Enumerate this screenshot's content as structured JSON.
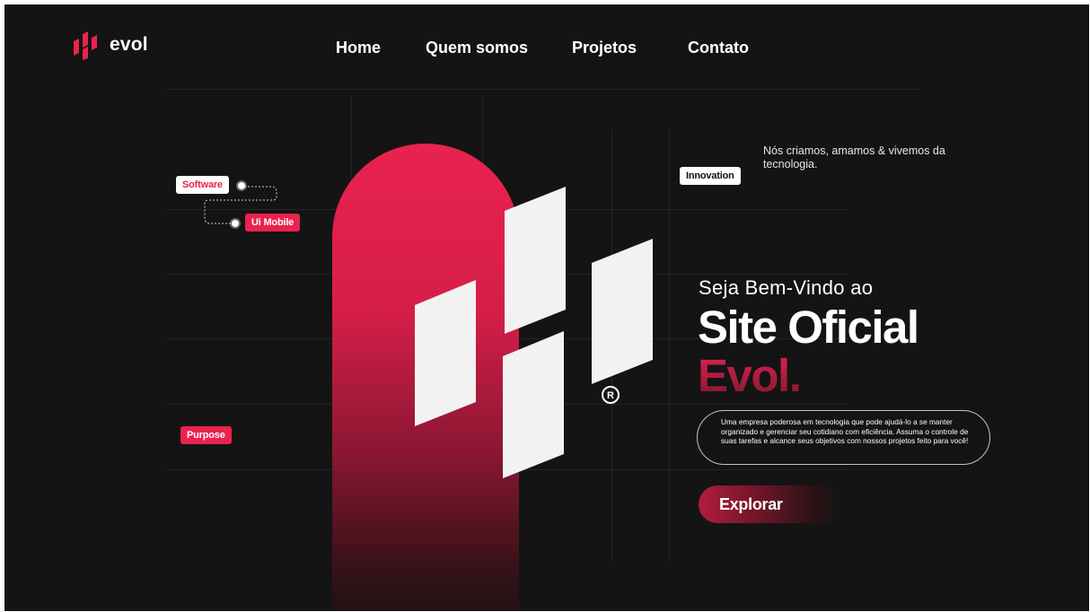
{
  "brand": {
    "name": "evol",
    "logo_icon": "evol-logo-icon",
    "accent": "#e8234f",
    "background": "#141414"
  },
  "nav": {
    "items": [
      {
        "label": "Home"
      },
      {
        "label": "Quem somos"
      },
      {
        "label": "Projetos"
      },
      {
        "label": "Contato"
      }
    ]
  },
  "tags": {
    "software": "Software",
    "ui_mobile": "Ui Mobile",
    "purpose": "Purpose",
    "innovation": "Innovation"
  },
  "hero": {
    "tagline": "Nós criamos, amamos & vivemos da tecnologia.",
    "welcome": "Seja Bem-Vindo ao",
    "title": "Site Oficial",
    "brand_title": "Evol.",
    "description": "Uma empresa poderosa em tecnologia que pode ajudá-lo a se manter organizado e gerenciar seu cotidiano com eficiência. Assuma o controle de suas tarefas e alcance seus objetivos com nossos projetos feito para você!",
    "cta_label": "Explorar",
    "registered_symbol": "®"
  }
}
